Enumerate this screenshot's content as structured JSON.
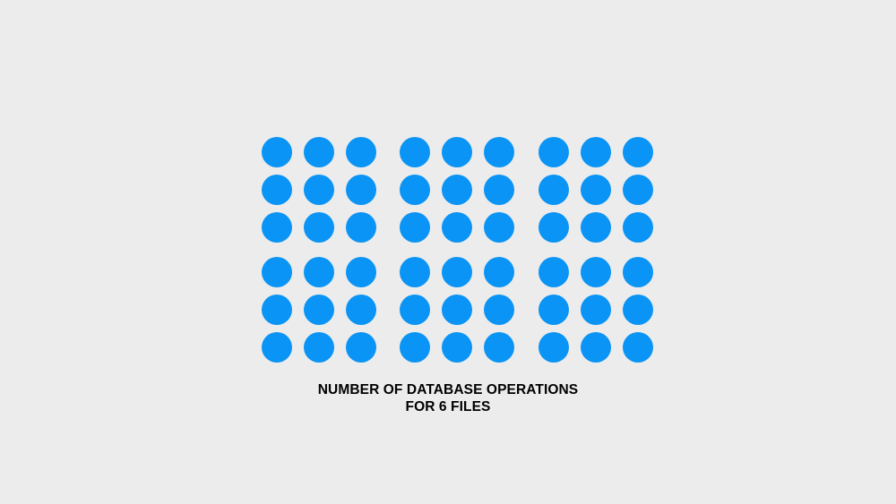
{
  "caption": {
    "line1": "NUMBER OF DATABASE OPERATIONS",
    "line2": "FOR 6 FILES"
  },
  "grid": {
    "blocks_across": 3,
    "blocks_down": 2,
    "dots_per_block_across": 3,
    "dots_per_block_down": 3,
    "dot_color": "#0a94f5"
  },
  "colors": {
    "background": "#ececec",
    "text": "#000000"
  }
}
